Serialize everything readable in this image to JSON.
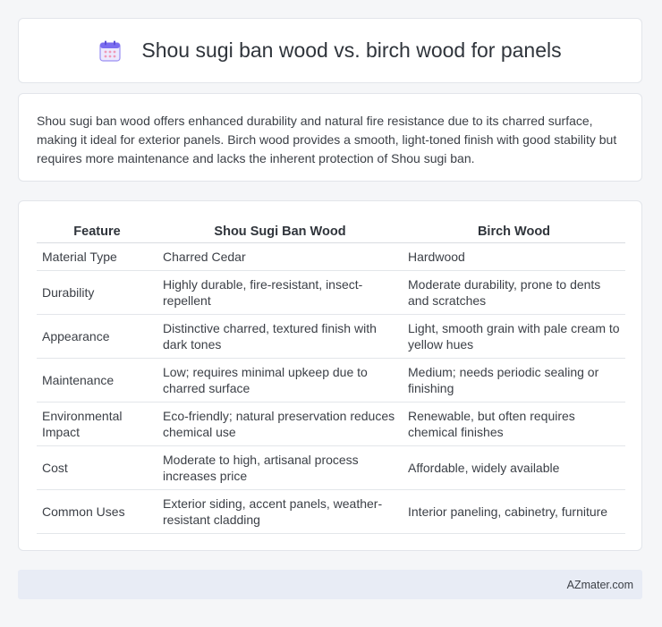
{
  "header": {
    "title": "Shou sugi ban wood vs. birch wood for panels",
    "icon": "calendar-icon",
    "icon_color": "#7a6cf0"
  },
  "intro": {
    "text": "Shou sugi ban wood offers enhanced durability and natural fire resistance due to its charred surface, making it ideal for exterior panels. Birch wood provides a smooth, light-toned finish with good stability but requires more maintenance and lacks the inherent protection of Shou sugi ban."
  },
  "table": {
    "headers": [
      "Feature",
      "Shou Sugi Ban Wood",
      "Birch Wood"
    ],
    "rows": [
      [
        "Material Type",
        "Charred Cedar",
        "Hardwood"
      ],
      [
        "Durability",
        "Highly durable, fire-resistant, insect-repellent",
        "Moderate durability, prone to dents and scratches"
      ],
      [
        "Appearance",
        "Distinctive charred, textured finish with dark tones",
        "Light, smooth grain with pale cream to yellow hues"
      ],
      [
        "Maintenance",
        "Low; requires minimal upkeep due to charred surface",
        "Medium; needs periodic sealing or finishing"
      ],
      [
        "Environmental Impact",
        "Eco-friendly; natural preservation reduces chemical use",
        "Renewable, but often requires chemical finishes"
      ],
      [
        "Cost",
        "Moderate to high, artisanal process increases price",
        "Affordable, widely available"
      ],
      [
        "Common Uses",
        "Exterior siding, accent panels, weather-resistant cladding",
        "Interior paneling, cabinetry, furniture"
      ]
    ]
  },
  "footer": {
    "text": "AZmater.com"
  }
}
